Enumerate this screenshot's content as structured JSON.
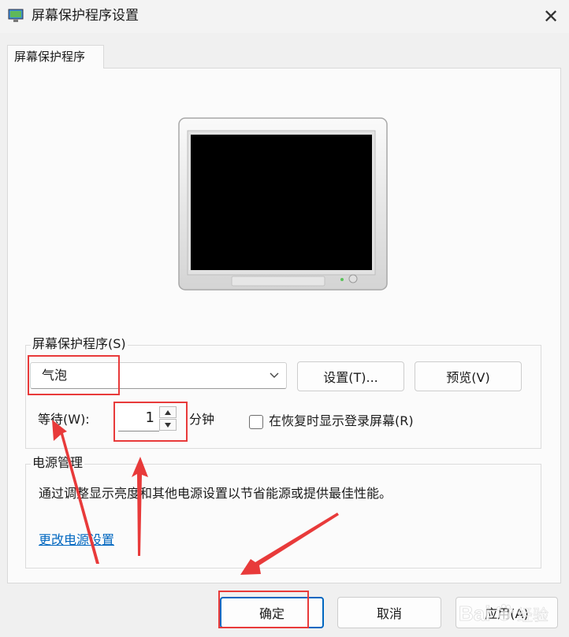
{
  "window": {
    "title": "屏幕保护程序设置",
    "close_glyph": "✕"
  },
  "tabs": [
    {
      "label": "屏幕保护程序"
    }
  ],
  "screensaver_group": {
    "label": "屏幕保护程序(S)",
    "selected": "气泡",
    "settings_button": "设置(T)...",
    "preview_button": "预览(V)",
    "wait_label": "等待(W):",
    "wait_value": "1",
    "wait_unit": "分钟",
    "resume_checkbox_label": "在恢复时显示登录屏幕(R)",
    "resume_checked": false
  },
  "power_group": {
    "label": "电源管理",
    "description": "通过调整显示亮度和其他电源设置以节省能源或提供最佳性能。",
    "link": "更改电源设置"
  },
  "footer": {
    "ok": "确定",
    "cancel": "取消",
    "apply": "应用(A)"
  },
  "colors": {
    "annotation": "#e83a3a",
    "link": "#0067c0",
    "accent": "#0067c0"
  },
  "watermark": {
    "text": "Baidu经验"
  }
}
